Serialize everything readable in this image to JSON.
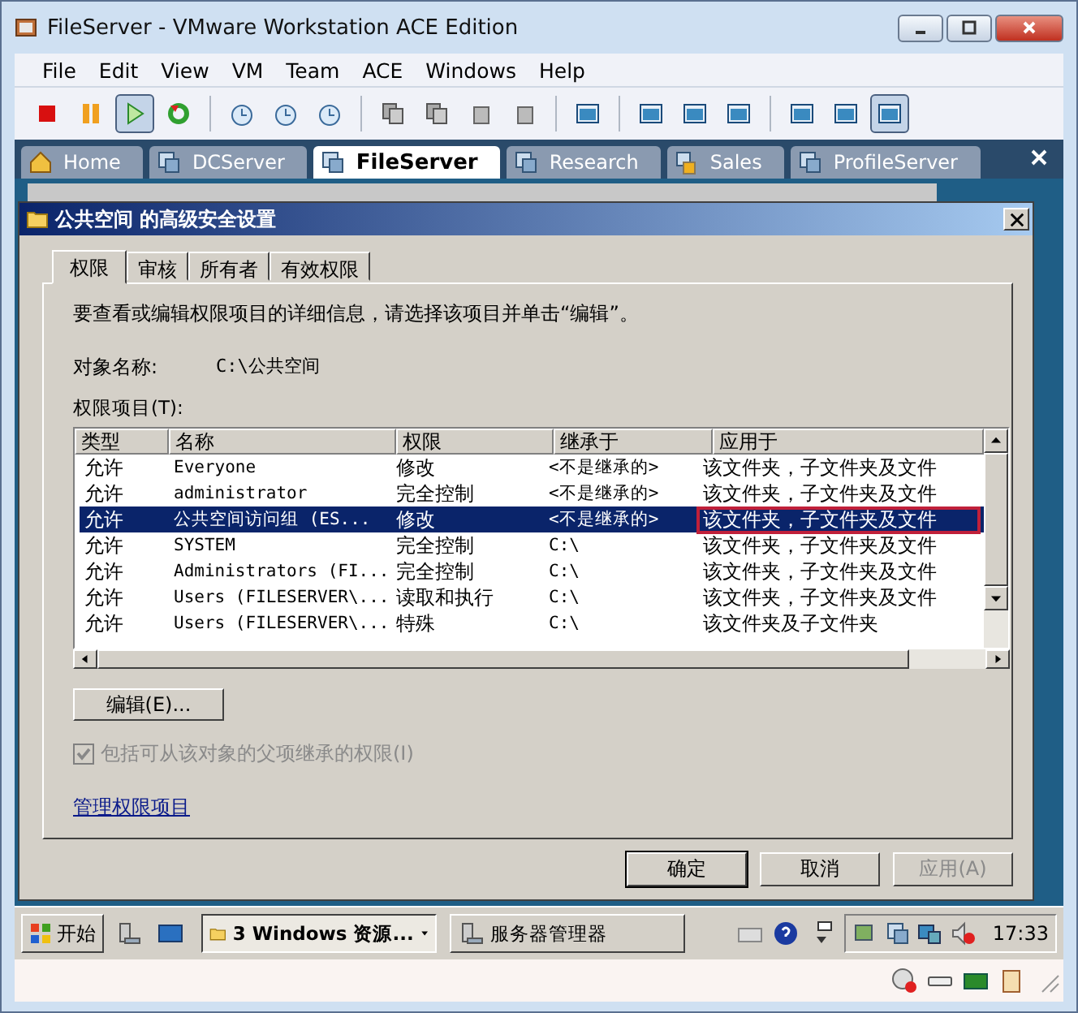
{
  "window": {
    "title": "FileServer - VMware Workstation ACE Edition"
  },
  "menu": [
    "File",
    "Edit",
    "View",
    "VM",
    "Team",
    "ACE",
    "Windows",
    "Help"
  ],
  "toolbar_groups": [
    {
      "buttons": [
        {
          "kind": "stop",
          "selected": false
        },
        {
          "kind": "pause",
          "selected": false
        },
        {
          "kind": "play",
          "selected": true
        },
        {
          "kind": "reset",
          "selected": false
        }
      ]
    },
    {
      "buttons": [
        {
          "kind": "snapshot",
          "selected": false
        },
        {
          "kind": "revert",
          "selected": false
        },
        {
          "kind": "manager",
          "selected": false
        }
      ]
    },
    {
      "buttons": [
        {
          "kind": "team",
          "selected": false
        },
        {
          "kind": "team",
          "selected": false
        },
        {
          "kind": "device",
          "selected": false
        },
        {
          "kind": "usb",
          "selected": false
        }
      ]
    },
    {
      "buttons": [
        {
          "kind": "console",
          "selected": false
        }
      ]
    },
    {
      "buttons": [
        {
          "kind": "sidebar",
          "selected": false
        },
        {
          "kind": "full",
          "selected": false
        },
        {
          "kind": "quick",
          "selected": false
        }
      ]
    },
    {
      "buttons": [
        {
          "kind": "settings",
          "selected": false
        },
        {
          "kind": "power",
          "selected": false
        },
        {
          "kind": "views",
          "selected": true
        }
      ]
    }
  ],
  "vm_tabs": [
    {
      "label": "Home",
      "kind": "home",
      "selected": false
    },
    {
      "label": "DCServer",
      "kind": "vm",
      "selected": false
    },
    {
      "label": "FileServer",
      "kind": "vm",
      "selected": true
    },
    {
      "label": "Research",
      "kind": "vm",
      "selected": false
    },
    {
      "label": "Sales",
      "kind": "team",
      "selected": false
    },
    {
      "label": "ProfileServer",
      "kind": "vm",
      "selected": false
    }
  ],
  "dialog": {
    "title": "公共空间 的高级安全设置",
    "tabs": [
      {
        "label": "权限",
        "selected": true
      },
      {
        "label": "审核",
        "selected": false
      },
      {
        "label": "所有者",
        "selected": false
      },
      {
        "label": "有效权限",
        "selected": false
      }
    ],
    "intro": "要查看或编辑权限项目的详细信息，请选择该项目并单击“编辑”。",
    "object_label": "对象名称:",
    "object_value": "C:\\公共空间",
    "entries_label": "权限项目(T):",
    "columns": [
      "类型",
      "名称",
      "权限",
      "继承于",
      "应用于"
    ],
    "rows": [
      {
        "cells": [
          "允许",
          "Everyone",
          "修改",
          "<不是继承的>",
          "该文件夹，子文件夹及文件"
        ],
        "selected": false,
        "outlined": false
      },
      {
        "cells": [
          "允许",
          "administrator",
          "完全控制",
          "<不是继承的>",
          "该文件夹，子文件夹及文件"
        ],
        "selected": false,
        "outlined": false
      },
      {
        "cells": [
          "允许",
          "公共空间访问组 (ES...",
          "修改",
          "<不是继承的>",
          "该文件夹，子文件夹及文件"
        ],
        "selected": true,
        "outlined": true
      },
      {
        "cells": [
          "允许",
          "SYSTEM",
          "完全控制",
          "C:\\",
          "该文件夹，子文件夹及文件"
        ],
        "selected": false,
        "outlined": false
      },
      {
        "cells": [
          "允许",
          "Administrators (FI...",
          "完全控制",
          "C:\\",
          "该文件夹，子文件夹及文件"
        ],
        "selected": false,
        "outlined": false
      },
      {
        "cells": [
          "允许",
          "Users (FILESERVER\\...",
          "读取和执行",
          "C:\\",
          "该文件夹，子文件夹及文件"
        ],
        "selected": false,
        "outlined": false
      },
      {
        "cells": [
          "允许",
          "Users (FILESERVER\\...",
          "特殊",
          "C:\\",
          "该文件夹及子文件夹"
        ],
        "selected": false,
        "outlined": false
      }
    ],
    "edit_button": "编辑(E)...",
    "inherit": {
      "label": "包括可从该对象的父项继承的权限(I)",
      "checked": true,
      "disabled": true
    },
    "manage_link": "管理权限项目",
    "buttons": [
      {
        "label": "确定",
        "kind": "default",
        "disabled": false
      },
      {
        "label": "取消",
        "kind": "normal",
        "disabled": false
      },
      {
        "label": "应用(A)",
        "kind": "normal",
        "disabled": true
      }
    ]
  },
  "taskbar": {
    "start": "开始",
    "tasks": [
      {
        "label": "3 Windows 资源...",
        "kind": "group",
        "selected": true
      },
      {
        "label": "服务器管理器",
        "kind": "app",
        "selected": false
      }
    ],
    "clock": "17:33"
  }
}
